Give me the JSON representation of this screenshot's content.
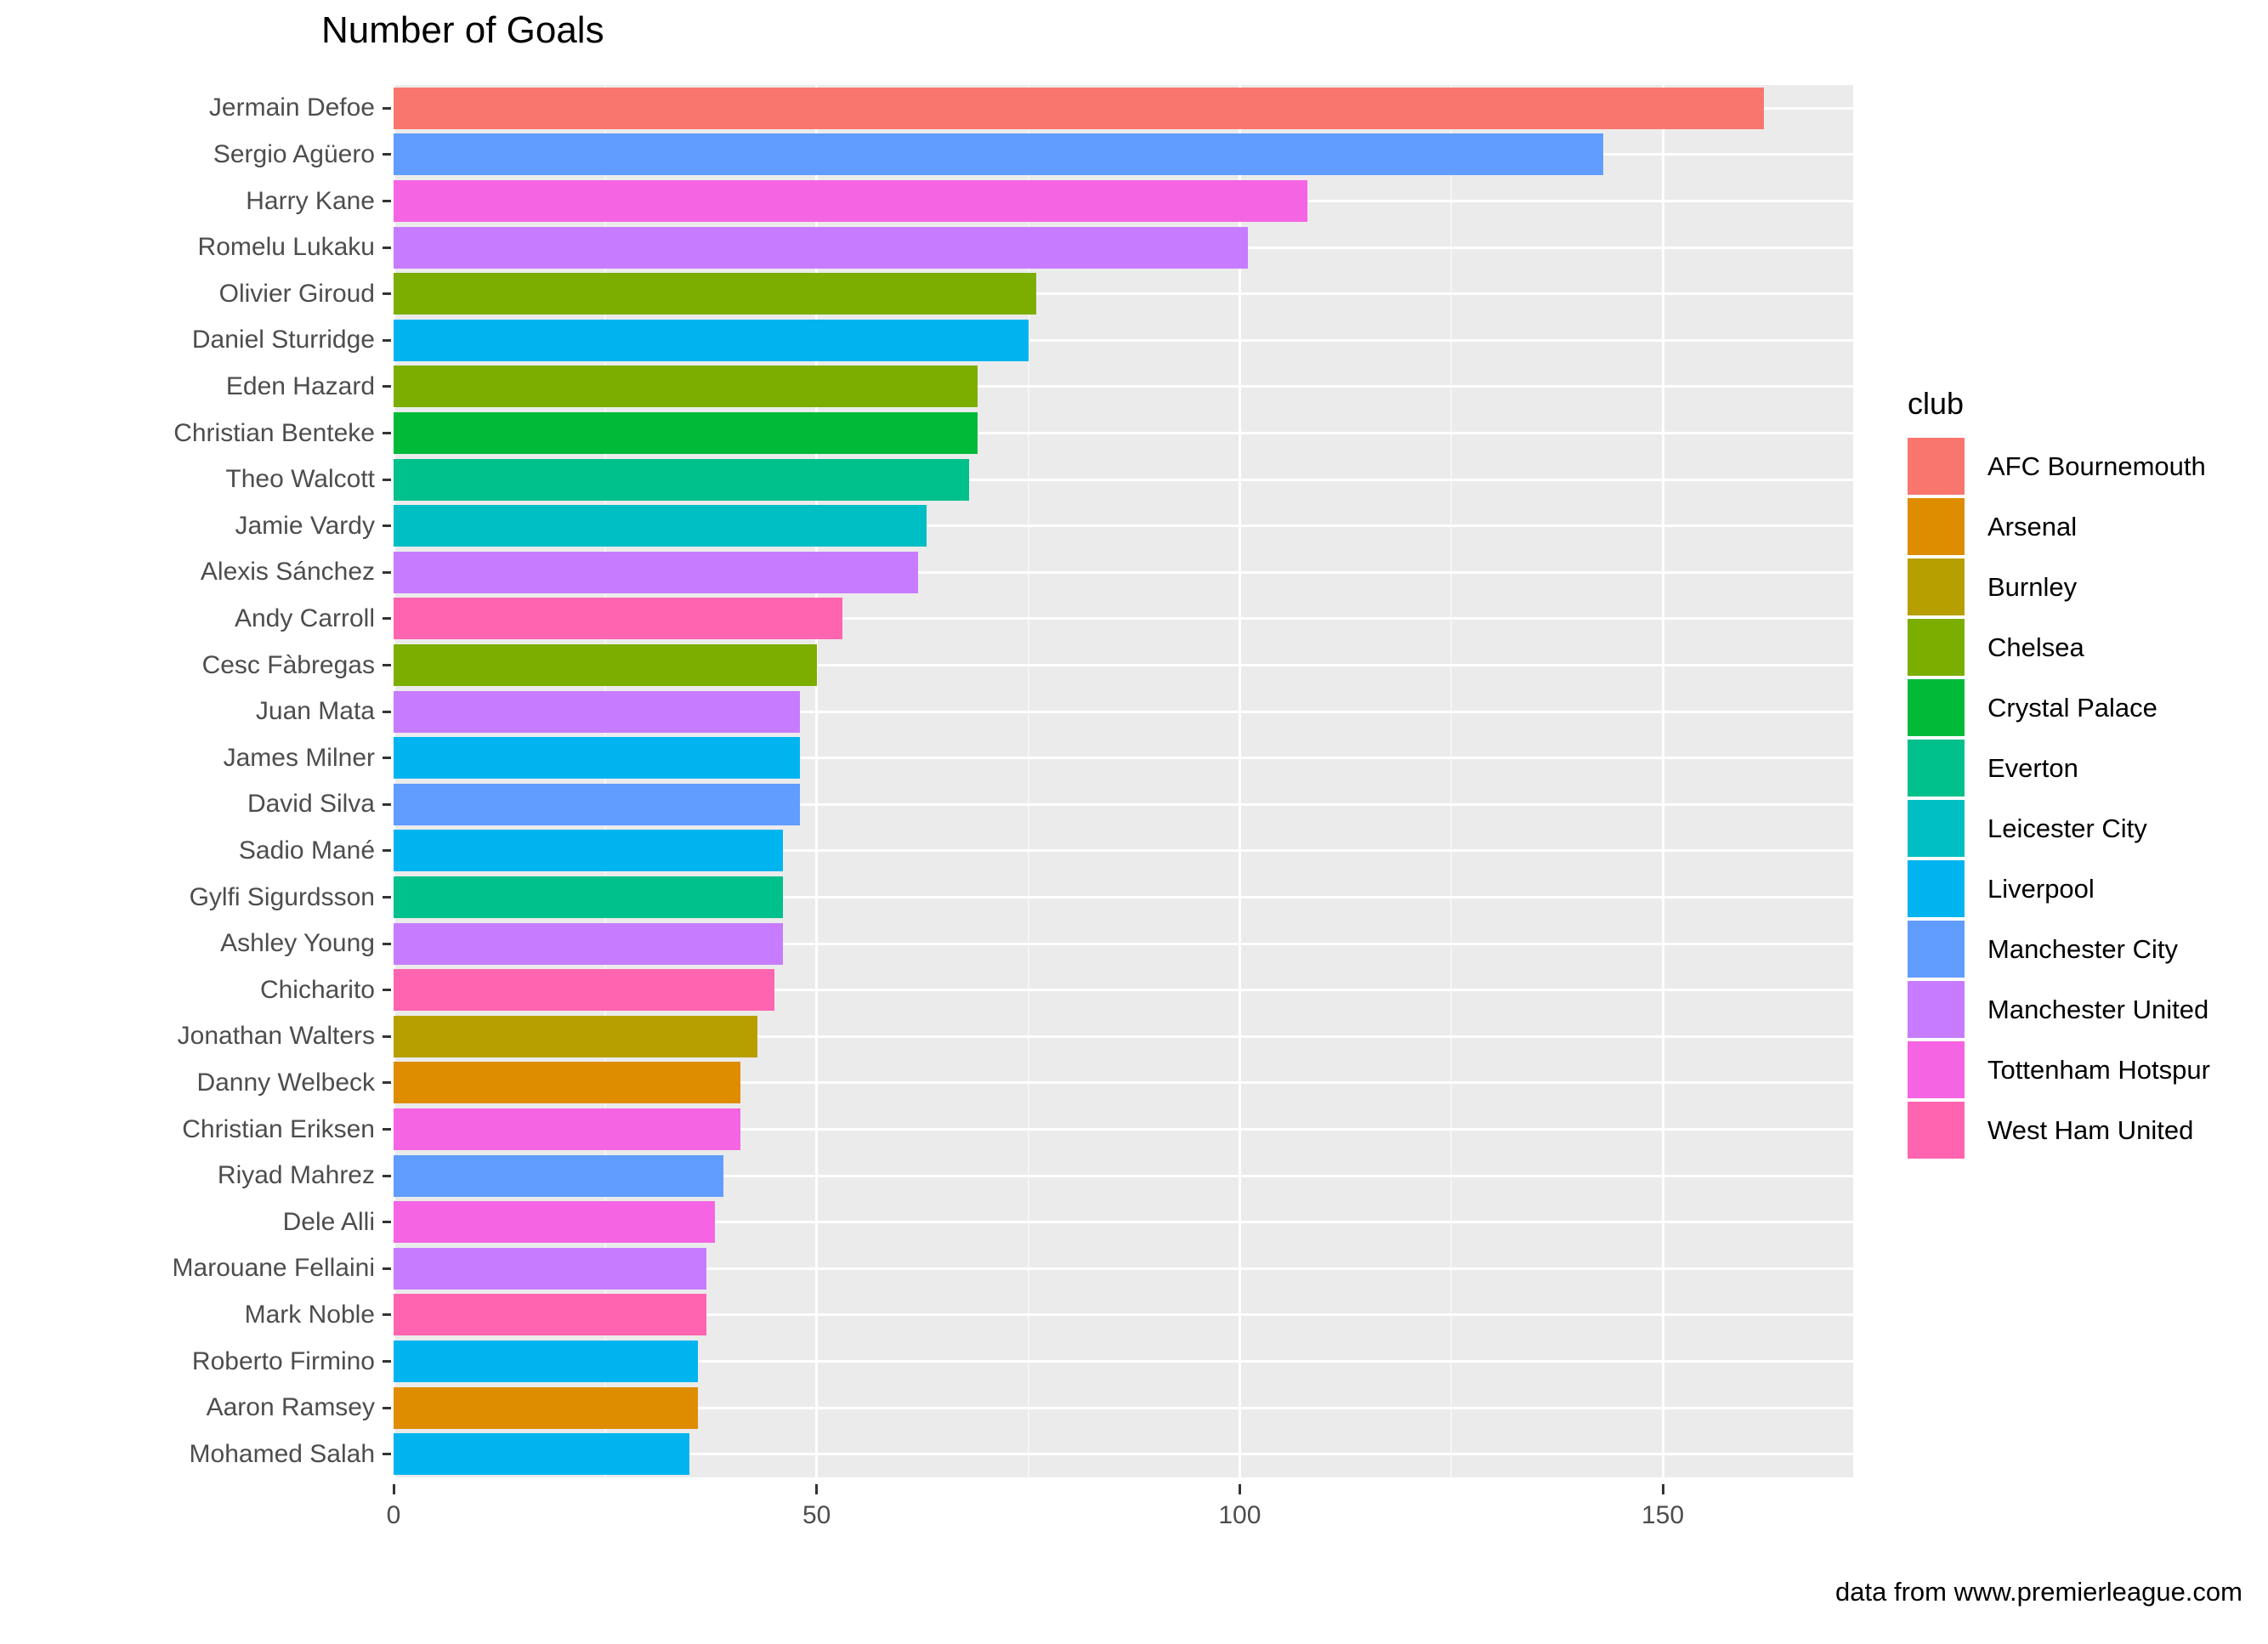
{
  "chart": {
    "title": "Number of Goals",
    "caption": "data from www.premierleague.com",
    "legend_title": "club"
  },
  "chart_data": {
    "type": "bar",
    "orientation": "horizontal",
    "title": "Number of Goals",
    "xlabel": "",
    "ylabel": "",
    "xlim": [
      0,
      172.5
    ],
    "xticks": [
      0,
      50,
      100,
      150
    ],
    "xtick_labels": [
      "0",
      "50",
      "100",
      "150"
    ],
    "grid": true,
    "legend_position": "right",
    "legend_title": "club",
    "caption": "data from www.premierleague.com",
    "categories": [
      "Jermain Defoe",
      "Sergio Agüero",
      "Harry Kane",
      "Romelu Lukaku",
      "Olivier Giroud",
      "Daniel Sturridge",
      "Eden Hazard",
      "Christian Benteke",
      "Theo Walcott",
      "Jamie Vardy",
      "Alexis Sánchez",
      "Andy Carroll",
      "Cesc Fàbregas",
      "Juan Mata",
      "James Milner",
      "David Silva",
      "Sadio Mané",
      "Gylfi Sigurdsson",
      "Ashley Young",
      "Chicharito",
      "Jonathan Walters",
      "Danny Welbeck",
      "Christian Eriksen",
      "Riyad Mahrez",
      "Dele Alli",
      "Marouane Fellaini",
      "Mark Noble",
      "Roberto Firmino",
      "Aaron Ramsey",
      "Mohamed Salah"
    ],
    "values": [
      162,
      143,
      108,
      101,
      76,
      75,
      69,
      69,
      68,
      63,
      62,
      53,
      50,
      48,
      48,
      48,
      46,
      46,
      46,
      45,
      43,
      41,
      41,
      39,
      38,
      37,
      37,
      36,
      36,
      35
    ],
    "groups": [
      "AFC Bournemouth",
      "Manchester City",
      "Tottenham Hotspur",
      "Manchester United",
      "Chelsea",
      "Liverpool",
      "Chelsea",
      "Crystal Palace",
      "Everton",
      "Leicester City",
      "Manchester United",
      "West Ham United",
      "Chelsea",
      "Manchester United",
      "Liverpool",
      "Manchester City",
      "Liverpool",
      "Everton",
      "Manchester United",
      "West Ham United",
      "Burnley",
      "Arsenal",
      "Tottenham Hotspur",
      "Manchester City",
      "Tottenham Hotspur",
      "Manchester United",
      "West Ham United",
      "Liverpool",
      "Arsenal",
      "Liverpool"
    ]
  },
  "legend": {
    "items": [
      {
        "label": "AFC Bournemouth",
        "color": "#F8766D"
      },
      {
        "label": "Arsenal",
        "color": "#DE8C00"
      },
      {
        "label": "Burnley",
        "color": "#B79F00"
      },
      {
        "label": "Chelsea",
        "color": "#7CAE00"
      },
      {
        "label": "Crystal Palace",
        "color": "#00BA38"
      },
      {
        "label": "Everton",
        "color": "#00C08B"
      },
      {
        "label": "Leicester City",
        "color": "#00BFC4"
      },
      {
        "label": "Liverpool",
        "color": "#00B4F0"
      },
      {
        "label": "Manchester City",
        "color": "#619CFF"
      },
      {
        "label": "Manchester United",
        "color": "#C77CFF"
      },
      {
        "label": "Tottenham Hotspur",
        "color": "#F564E3"
      },
      {
        "label": "West Ham United",
        "color": "#FF64B0"
      }
    ]
  }
}
